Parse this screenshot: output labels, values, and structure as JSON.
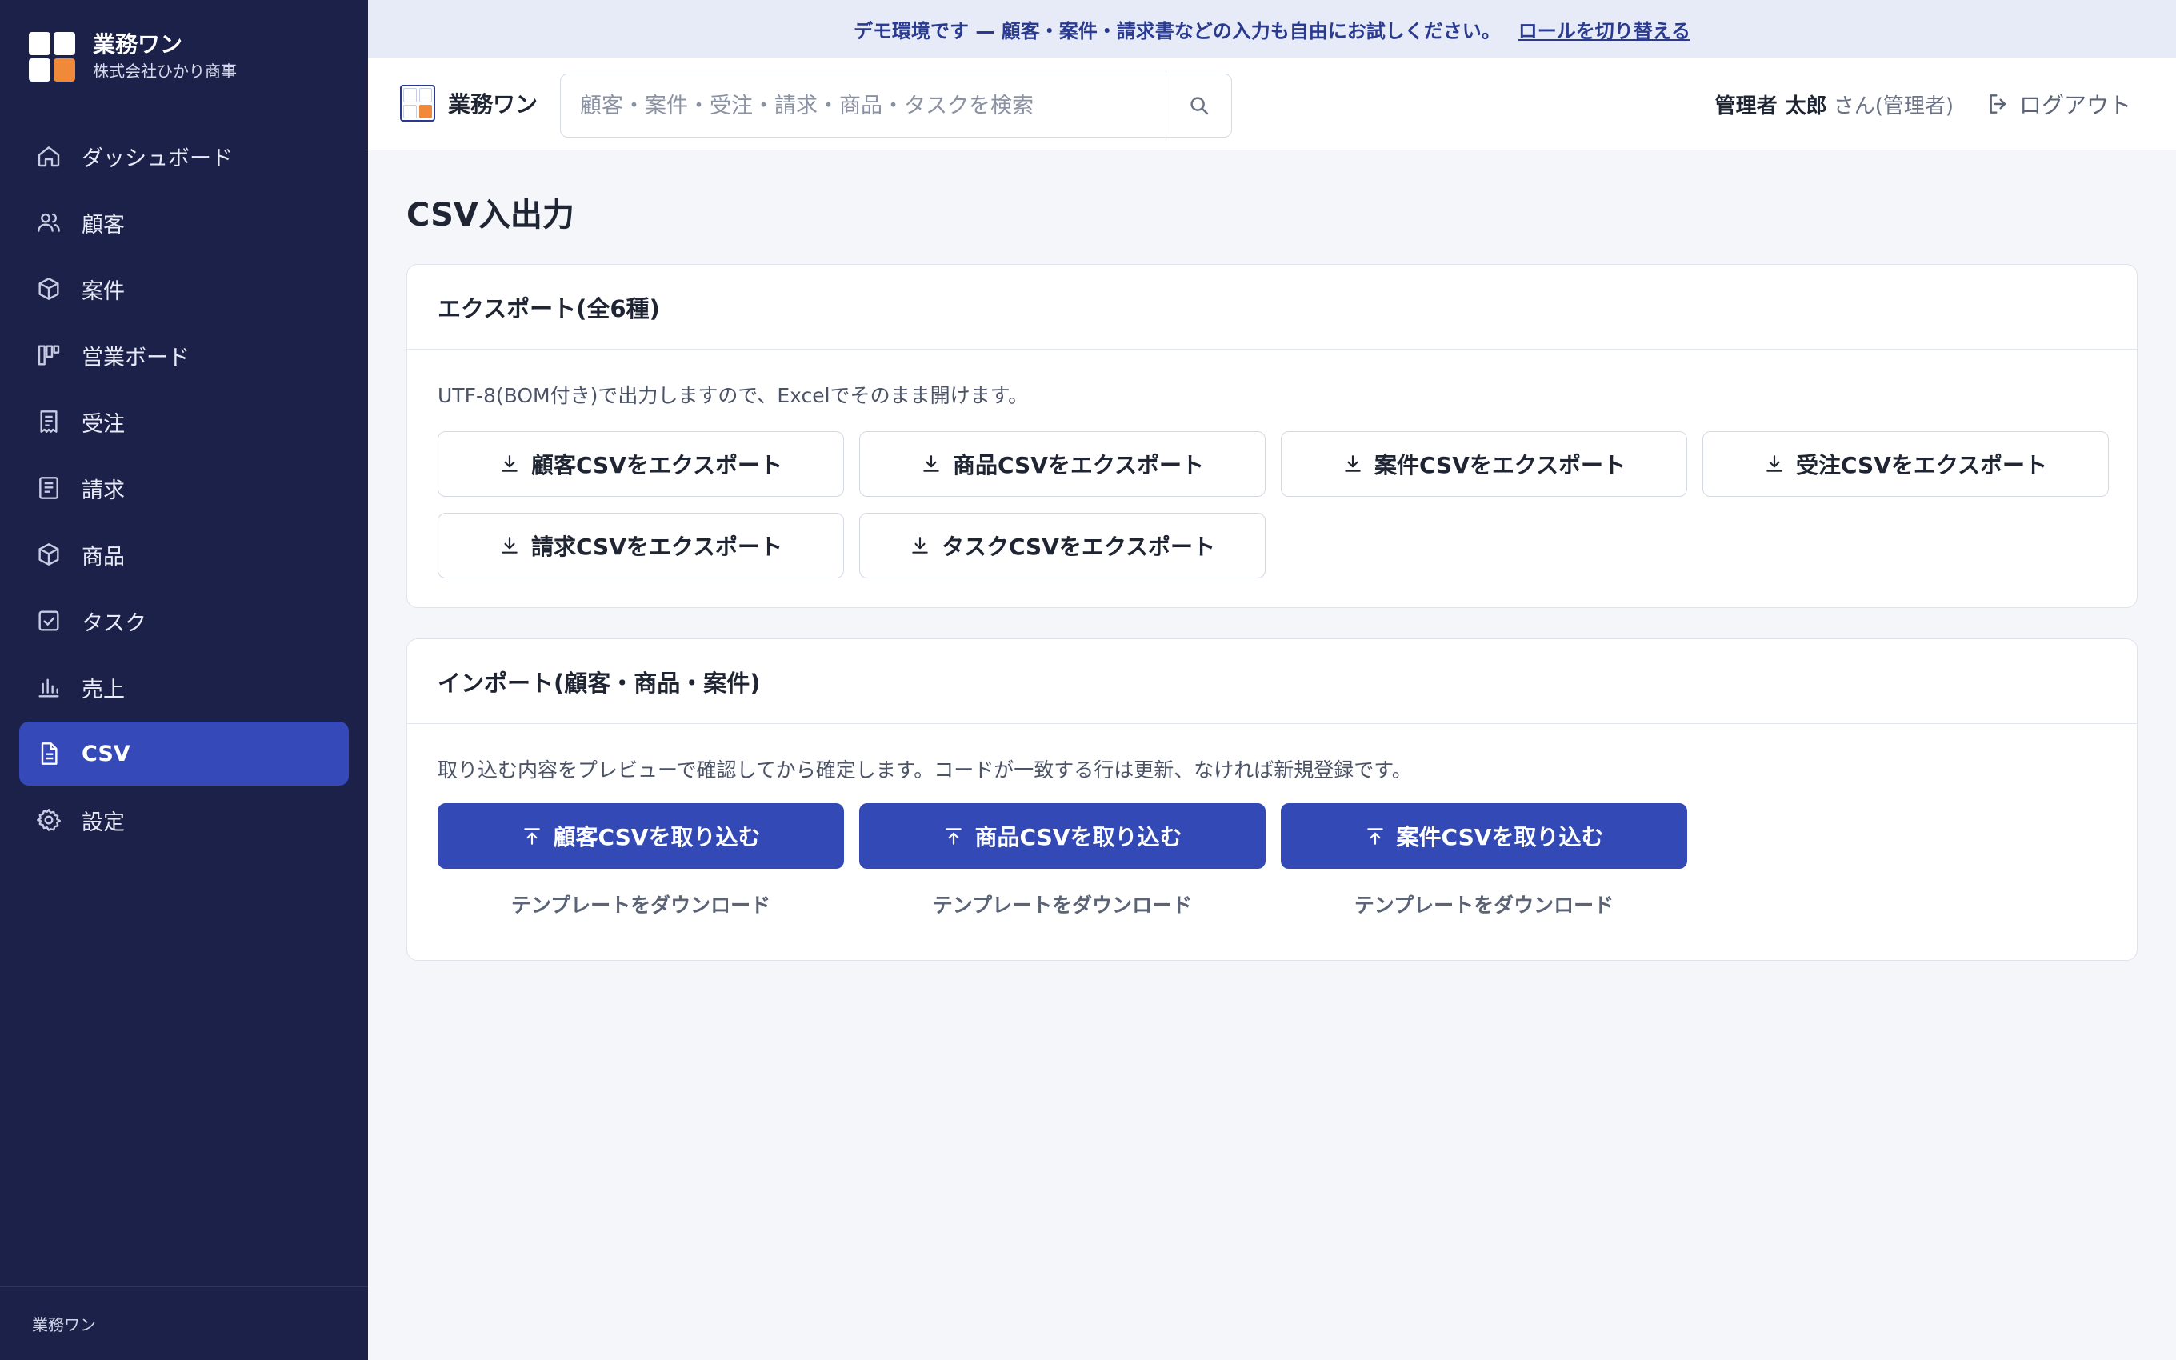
{
  "sidebar": {
    "brand_name": "業務ワン",
    "company": "株式会社ひかり商事",
    "items": [
      {
        "label": "ダッシュボード",
        "icon": "home-icon"
      },
      {
        "label": "顧客",
        "icon": "users-icon"
      },
      {
        "label": "案件",
        "icon": "box-icon"
      },
      {
        "label": "営業ボード",
        "icon": "kanban-icon"
      },
      {
        "label": "受注",
        "icon": "receipt-icon"
      },
      {
        "label": "請求",
        "icon": "invoice-icon"
      },
      {
        "label": "商品",
        "icon": "package-icon"
      },
      {
        "label": "タスク",
        "icon": "checkbox-icon"
      },
      {
        "label": "売上",
        "icon": "bar-chart-icon"
      },
      {
        "label": "CSV",
        "icon": "file-icon",
        "active": true
      },
      {
        "label": "設定",
        "icon": "gear-icon"
      }
    ],
    "footer": "業務ワン"
  },
  "banner": {
    "text": "デモ環境です — 顧客・案件・請求書などの入力も自由にお試しください。",
    "link": "ロールを切り替える"
  },
  "header": {
    "brand_name": "業務ワン",
    "search_placeholder": "顧客・案件・受注・請求・商品・タスクを検索",
    "user_role": "管理者",
    "user_name": "太郎",
    "user_suffix": "さん(管理者)",
    "logout": "ログアウト"
  },
  "main": {
    "title": "CSV入出力",
    "export": {
      "heading": "エクスポート(全6種)",
      "description": "UTF-8(BOM付き)で出力しますので、Excelでそのまま開けます。",
      "buttons": [
        "顧客CSVをエクスポート",
        "商品CSVをエクスポート",
        "案件CSVをエクスポート",
        "受注CSVをエクスポート",
        "請求CSVをエクスポート",
        "タスクCSVをエクスポート"
      ]
    },
    "import": {
      "heading": "インポート(顧客・商品・案件)",
      "description": "取り込む内容をプレビューで確認してから確定します。コードが一致する行は更新、なければ新規登録です。",
      "buttons": [
        "顧客CSVを取り込む",
        "商品CSVを取り込む",
        "案件CSVを取り込む"
      ],
      "template_link": "テンプレートをダウンロード"
    }
  },
  "colors": {
    "sidebar_bg": "#1b2148",
    "accent": "#3349b6",
    "logo_orange": "#f08a3a"
  }
}
